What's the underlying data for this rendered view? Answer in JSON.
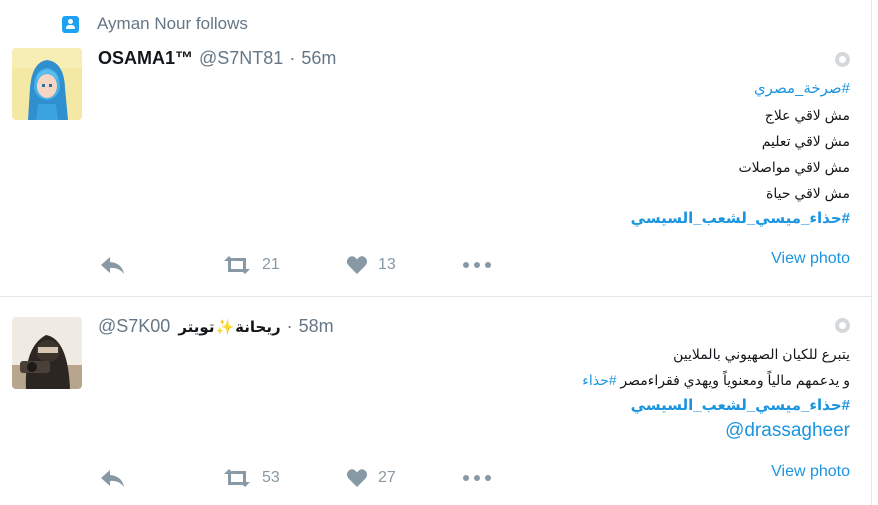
{
  "context": {
    "text": "Ayman Nour follows",
    "icon": "person-follow-icon"
  },
  "tweets": [
    {
      "display_name": "OSAMA1™",
      "username": "@S7NT81",
      "separator": "·",
      "time": "56m",
      "lines": [
        "#صرخة_مصري",
        "مش لاقي علاج",
        "مش لاقي تعليم",
        "مش لاقي مواصلات",
        "مش لاقي حياة",
        "#حذاء_ميسي_لشعب_السيسي"
      ],
      "view_photo": "View photo",
      "retweets": "21",
      "likes": "13"
    },
    {
      "display_name_ar1": "ريحانة",
      "display_name_ar2": "تويتر",
      "username": "@S7K00",
      "separator": "·",
      "time": "58m",
      "lines": [
        "يتبرع للكيان الصهيوني بالملايين",
        "و يدعمهم مالياً ومعنوياً ويهدي فقراءمصر",
        "#حذاء",
        "#حذاء_ميسي_لشعب_السيسي",
        "@drassagheer"
      ],
      "view_photo": "View photo",
      "retweets": "53",
      "likes": "27"
    }
  ],
  "colors": {
    "link": "#1b95e0",
    "muted": "#657786",
    "icon": "#8899a6"
  }
}
